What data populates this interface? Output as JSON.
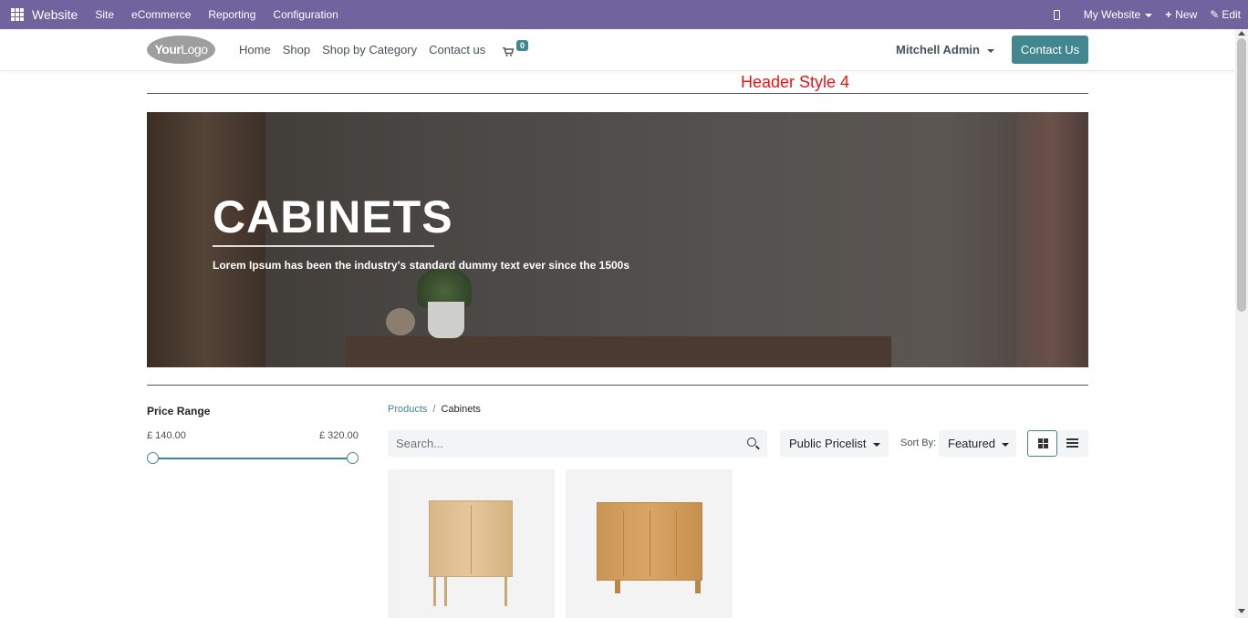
{
  "admin_bar": {
    "app_name": "Website",
    "menus": [
      "Site",
      "eCommerce",
      "Reporting",
      "Configuration"
    ],
    "my_website": "My Website",
    "new_label": "New",
    "edit_label": "Edit"
  },
  "header": {
    "logo_bold": "Your",
    "logo_light": "Logo",
    "nav": [
      "Home",
      "Shop",
      "Shop by Category",
      "Contact us"
    ],
    "cart_count": "0",
    "user_name": "Mitchell Admin",
    "contact_button": "Contact Us",
    "accent_color": "#42878f",
    "admin_color": "#71639e"
  },
  "annotation": "Header Style 4",
  "hero": {
    "title": "CABINETS",
    "subtitle": "Lorem Ipsum has been the industry's standard dummy text ever since the 1500s"
  },
  "sidebar": {
    "price_title": "Price Range",
    "price_min": "£ 140.00",
    "price_max": "£ 320.00"
  },
  "breadcrumb": {
    "root": "Products",
    "separator": "/",
    "current": "Cabinets"
  },
  "toolbar": {
    "search_placeholder": "Search...",
    "pricelist": "Public Pricelist",
    "sort_label": "Sort By:",
    "sort_value": "Featured"
  },
  "products": [
    {
      "image": "herringbone-cabinet"
    },
    {
      "image": "oak-sideboard"
    }
  ]
}
